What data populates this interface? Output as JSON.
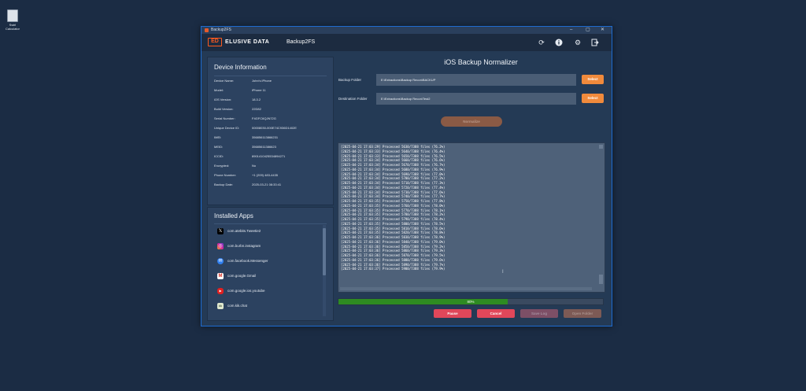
{
  "desktop": {
    "icon_label": "Swirl Calculator"
  },
  "window": {
    "title": "Backup2FS",
    "controls": [
      "–",
      "▢",
      "✕"
    ]
  },
  "header": {
    "brand": "ELUSIVE DATA",
    "logo_text": "ED",
    "app_name": "Backup2FS"
  },
  "device_info": {
    "title": "Device Information",
    "fields": [
      {
        "label": "Device Name:",
        "value": "John's iPhone"
      },
      {
        "label": "Model:",
        "value": "iPhone 11"
      },
      {
        "label": "iOS Version:",
        "value": "18.3.2"
      },
      {
        "label": "Build Version:",
        "value": "22D82"
      },
      {
        "label": "Serial Number:",
        "value": "F4GFC6QJN72G"
      },
      {
        "label": "Unique Device ID:",
        "value": "00008030-000E74C936D1402E"
      },
      {
        "label": "IMEI:",
        "value": "356856113866231"
      },
      {
        "label": "MEID:",
        "value": "35685611386623"
      },
      {
        "label": "ICCID:",
        "value": "8901410425534894271"
      },
      {
        "label": "Encrypted:",
        "value": "No"
      },
      {
        "label": "Phone Number:",
        "value": "+1 (209) 483-4435"
      },
      {
        "label": "Backup Date:",
        "value": "2025-03-21 08:33:41"
      }
    ]
  },
  "installed_apps": {
    "title": "Installed Apps",
    "items": [
      {
        "name": "com.atebits.Tweetie2",
        "icon": "x-icon",
        "glyph": "𝕏",
        "color": "#000000"
      },
      {
        "name": "com.burbn.instagram",
        "icon": "instagram-icon",
        "glyph": "◎",
        "color": "#d6249f"
      },
      {
        "name": "com.facebook.Messenger",
        "icon": "messenger-icon",
        "glyph": "✉",
        "color": "#2f7ff0"
      },
      {
        "name": "com.google.Gmail",
        "icon": "gmail-icon",
        "glyph": "M",
        "color": "#ffffff"
      },
      {
        "name": "com.google.ios.youtube",
        "icon": "youtube-icon",
        "glyph": "▶",
        "color": "#e02020"
      },
      {
        "name": "com.kik.chat",
        "icon": "kik-icon",
        "glyph": "kik",
        "color": "#dfe8cf"
      }
    ]
  },
  "main": {
    "title": "iOS Backup Normalizer",
    "backup_folder": {
      "label": "Backup Folder",
      "value": "E:\\Extractions\\Backup Recon\\BACKUP",
      "button": "Select"
    },
    "destination_folder": {
      "label": "Destination Folder",
      "value": "E:\\Extractions\\Backup Recon\\Test2",
      "button": "Select"
    },
    "normalize_button": "Normalize",
    "log_lines": [
      "[2025-04-21 17:03:29] Processed 5630/7388 files (76.2%)",
      "[2025-04-21 17:03:33] Processed 5640/7388 files (76.4%)",
      "[2025-04-21 17:03:33] Processed 5650/7388 files (76.5%)",
      "[2025-04-21 17:03:34] Processed 5660/7388 files (76.6%)",
      "[2025-04-21 17:03:34] Processed 5670/7388 files (76.7%)",
      "[2025-04-21 17:03:34] Processed 5680/7388 files (76.9%)",
      "[2025-04-21 17:03:34] Processed 5690/7388 files (77.0%)",
      "[2025-04-21 17:03:34] Processed 5700/7388 files (77.2%)",
      "[2025-04-21 17:03:34] Processed 5710/7388 files (77.3%)",
      "[2025-04-21 17:03:34] Processed 5720/7388 files (77.4%)",
      "[2025-04-21 17:03:34] Processed 5730/7388 files (77.6%)",
      "[2025-04-21 17:03:34] Processed 5740/7388 files (77.7%)",
      "[2025-04-21 17:03:35] Processed 5750/7388 files (77.8%)",
      "[2025-04-21 17:03:35] Processed 5760/7388 files (78.0%)",
      "[2025-04-21 17:03:35] Processed 5770/7388 files (78.1%)",
      "[2025-04-21 17:03:35] Processed 5780/7388 files (78.2%)",
      "[2025-04-21 17:03:35] Processed 5790/7388 files (78.4%)",
      "[2025-04-21 17:03:35] Processed 5800/7388 files (78.5%)",
      "[2025-04-21 17:03:35] Processed 5810/7388 files (78.6%)",
      "[2025-04-21 17:03:35] Processed 5820/7388 files (78.8%)",
      "[2025-04-21 17:03:36] Processed 5830/7388 files (78.9%)",
      "[2025-04-21 17:03:36] Processed 5840/7388 files (79.0%)",
      "[2025-04-21 17:03:36] Processed 5850/7388 files (79.2%)",
      "[2025-04-21 17:03:36] Processed 5860/7388 files (79.3%)",
      "[2025-04-21 17:03:36] Processed 5870/7388 files (79.5%)",
      "[2025-04-21 17:03:36] Processed 5880/7388 files (79.6%)",
      "[2025-04-21 17:03:36] Processed 5890/7388 files (79.7%)",
      "[2025-04-21 17:03:37] Processed 5900/7388 files (79.9%)"
    ],
    "progress": {
      "percent": 80,
      "label": "80%"
    },
    "buttons": {
      "pause": "Pause",
      "cancel": "Cancel",
      "save_log": "Save Log",
      "open_folder": "Open Folder"
    }
  },
  "colors": {
    "accent": "#f08a3c",
    "danger": "#e0475a",
    "success": "#2e8b22"
  }
}
